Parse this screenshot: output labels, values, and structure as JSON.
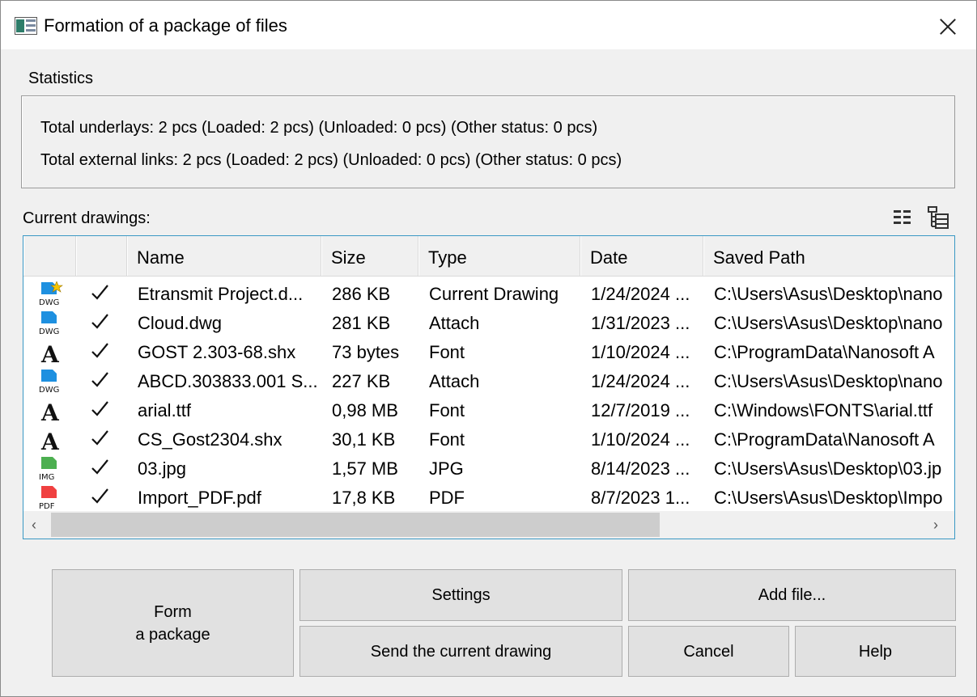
{
  "window": {
    "title": "Formation of a package of files",
    "app_icon": "window-app-icon",
    "close_icon": "close-icon"
  },
  "statistics": {
    "label": "Statistics",
    "line1": "Total underlays: 2 pcs (Loaded: 2 pcs) (Unloaded: 0 pcs) (Other status: 0 pcs)",
    "line2": "Total external links: 2 pcs (Loaded: 2 pcs) (Unloaded: 0 pcs) (Other status: 0 pcs)"
  },
  "current": {
    "label": "Current drawings:",
    "tools": [
      "list-view-icon",
      "tree-view-icon"
    ]
  },
  "table": {
    "columns": [
      "",
      "",
      "Name",
      "Size",
      "Type",
      "Date",
      "Saved Path"
    ],
    "rows": [
      {
        "icon": "dwg-current",
        "icon_label": "DWG",
        "name": "Etransmit Project.d...",
        "size": "286 KB",
        "type": "Current Drawing",
        "date": "1/24/2024 ...",
        "path": "C:\\Users\\Asus\\Desktop\\nano"
      },
      {
        "icon": "dwg",
        "icon_label": "DWG",
        "name": "Cloud.dwg",
        "size": "281 KB",
        "type": "Attach",
        "date": "1/31/2023 ...",
        "path": "C:\\Users\\Asus\\Desktop\\nano"
      },
      {
        "icon": "font",
        "icon_label": "A",
        "name": "GOST 2.303-68.shx",
        "size": "73 bytes",
        "type": "Font",
        "date": "1/10/2024 ...",
        "path": "C:\\ProgramData\\Nanosoft A"
      },
      {
        "icon": "dwg",
        "icon_label": "DWG",
        "name": "ABCD.303833.001 S...",
        "size": "227 KB",
        "type": "Attach",
        "date": "1/24/2024 ...",
        "path": "C:\\Users\\Asus\\Desktop\\nano"
      },
      {
        "icon": "font",
        "icon_label": "A",
        "name": "arial.ttf",
        "size": "0,98 MB",
        "type": "Font",
        "date": "12/7/2019 ...",
        "path": "C:\\Windows\\FONTS\\arial.ttf"
      },
      {
        "icon": "font",
        "icon_label": "A",
        "name": "CS_Gost2304.shx",
        "size": "30,1 KB",
        "type": "Font",
        "date": "1/10/2024 ...",
        "path": "C:\\ProgramData\\Nanosoft A"
      },
      {
        "icon": "img",
        "icon_label": "IMG",
        "name": "03.jpg",
        "size": "1,57 MB",
        "type": "JPG",
        "date": "8/14/2023 ...",
        "path": "C:\\Users\\Asus\\Desktop\\03.jp"
      },
      {
        "icon": "pdf",
        "icon_label": "PDF",
        "name": "Import_PDF.pdf",
        "size": "17,8 KB",
        "type": "PDF",
        "date": "8/7/2023 1...",
        "path": "C:\\Users\\Asus\\Desktop\\Impo"
      }
    ],
    "scrollbar": {
      "left_arrow": "‹",
      "right_arrow": "›"
    }
  },
  "buttons": {
    "form_package": "Form\na package",
    "settings": "Settings",
    "add_file": "Add file...",
    "send_current": "Send the current drawing",
    "cancel": "Cancel",
    "help": "Help"
  },
  "colors": {
    "accent_border": "#3a98c4",
    "dwg_blue": "#1e90e0",
    "img_green": "#4caf50",
    "pdf_red": "#f04040",
    "star_yellow": "#f5c400"
  }
}
